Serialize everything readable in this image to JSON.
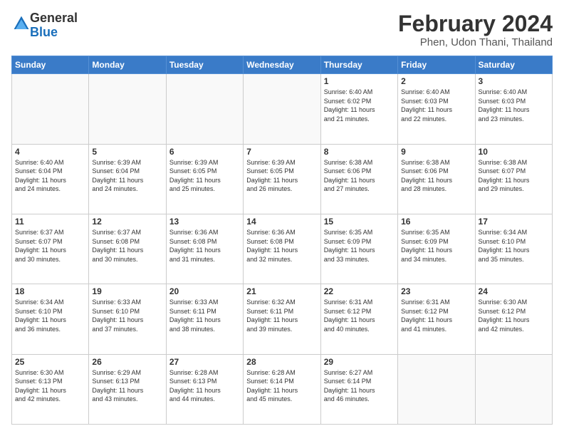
{
  "logo": {
    "general": "General",
    "blue": "Blue"
  },
  "header": {
    "month": "February 2024",
    "location": "Phen, Udon Thani, Thailand"
  },
  "weekdays": [
    "Sunday",
    "Monday",
    "Tuesday",
    "Wednesday",
    "Thursday",
    "Friday",
    "Saturday"
  ],
  "weeks": [
    [
      {
        "day": "",
        "info": ""
      },
      {
        "day": "",
        "info": ""
      },
      {
        "day": "",
        "info": ""
      },
      {
        "day": "",
        "info": ""
      },
      {
        "day": "1",
        "info": "Sunrise: 6:40 AM\nSunset: 6:02 PM\nDaylight: 11 hours\nand 21 minutes."
      },
      {
        "day": "2",
        "info": "Sunrise: 6:40 AM\nSunset: 6:03 PM\nDaylight: 11 hours\nand 22 minutes."
      },
      {
        "day": "3",
        "info": "Sunrise: 6:40 AM\nSunset: 6:03 PM\nDaylight: 11 hours\nand 23 minutes."
      }
    ],
    [
      {
        "day": "4",
        "info": "Sunrise: 6:40 AM\nSunset: 6:04 PM\nDaylight: 11 hours\nand 24 minutes."
      },
      {
        "day": "5",
        "info": "Sunrise: 6:39 AM\nSunset: 6:04 PM\nDaylight: 11 hours\nand 24 minutes."
      },
      {
        "day": "6",
        "info": "Sunrise: 6:39 AM\nSunset: 6:05 PM\nDaylight: 11 hours\nand 25 minutes."
      },
      {
        "day": "7",
        "info": "Sunrise: 6:39 AM\nSunset: 6:05 PM\nDaylight: 11 hours\nand 26 minutes."
      },
      {
        "day": "8",
        "info": "Sunrise: 6:38 AM\nSunset: 6:06 PM\nDaylight: 11 hours\nand 27 minutes."
      },
      {
        "day": "9",
        "info": "Sunrise: 6:38 AM\nSunset: 6:06 PM\nDaylight: 11 hours\nand 28 minutes."
      },
      {
        "day": "10",
        "info": "Sunrise: 6:38 AM\nSunset: 6:07 PM\nDaylight: 11 hours\nand 29 minutes."
      }
    ],
    [
      {
        "day": "11",
        "info": "Sunrise: 6:37 AM\nSunset: 6:07 PM\nDaylight: 11 hours\nand 30 minutes."
      },
      {
        "day": "12",
        "info": "Sunrise: 6:37 AM\nSunset: 6:08 PM\nDaylight: 11 hours\nand 30 minutes."
      },
      {
        "day": "13",
        "info": "Sunrise: 6:36 AM\nSunset: 6:08 PM\nDaylight: 11 hours\nand 31 minutes."
      },
      {
        "day": "14",
        "info": "Sunrise: 6:36 AM\nSunset: 6:08 PM\nDaylight: 11 hours\nand 32 minutes."
      },
      {
        "day": "15",
        "info": "Sunrise: 6:35 AM\nSunset: 6:09 PM\nDaylight: 11 hours\nand 33 minutes."
      },
      {
        "day": "16",
        "info": "Sunrise: 6:35 AM\nSunset: 6:09 PM\nDaylight: 11 hours\nand 34 minutes."
      },
      {
        "day": "17",
        "info": "Sunrise: 6:34 AM\nSunset: 6:10 PM\nDaylight: 11 hours\nand 35 minutes."
      }
    ],
    [
      {
        "day": "18",
        "info": "Sunrise: 6:34 AM\nSunset: 6:10 PM\nDaylight: 11 hours\nand 36 minutes."
      },
      {
        "day": "19",
        "info": "Sunrise: 6:33 AM\nSunset: 6:10 PM\nDaylight: 11 hours\nand 37 minutes."
      },
      {
        "day": "20",
        "info": "Sunrise: 6:33 AM\nSunset: 6:11 PM\nDaylight: 11 hours\nand 38 minutes."
      },
      {
        "day": "21",
        "info": "Sunrise: 6:32 AM\nSunset: 6:11 PM\nDaylight: 11 hours\nand 39 minutes."
      },
      {
        "day": "22",
        "info": "Sunrise: 6:31 AM\nSunset: 6:12 PM\nDaylight: 11 hours\nand 40 minutes."
      },
      {
        "day": "23",
        "info": "Sunrise: 6:31 AM\nSunset: 6:12 PM\nDaylight: 11 hours\nand 41 minutes."
      },
      {
        "day": "24",
        "info": "Sunrise: 6:30 AM\nSunset: 6:12 PM\nDaylight: 11 hours\nand 42 minutes."
      }
    ],
    [
      {
        "day": "25",
        "info": "Sunrise: 6:30 AM\nSunset: 6:13 PM\nDaylight: 11 hours\nand 42 minutes."
      },
      {
        "day": "26",
        "info": "Sunrise: 6:29 AM\nSunset: 6:13 PM\nDaylight: 11 hours\nand 43 minutes."
      },
      {
        "day": "27",
        "info": "Sunrise: 6:28 AM\nSunset: 6:13 PM\nDaylight: 11 hours\nand 44 minutes."
      },
      {
        "day": "28",
        "info": "Sunrise: 6:28 AM\nSunset: 6:14 PM\nDaylight: 11 hours\nand 45 minutes."
      },
      {
        "day": "29",
        "info": "Sunrise: 6:27 AM\nSunset: 6:14 PM\nDaylight: 11 hours\nand 46 minutes."
      },
      {
        "day": "",
        "info": ""
      },
      {
        "day": "",
        "info": ""
      }
    ]
  ]
}
